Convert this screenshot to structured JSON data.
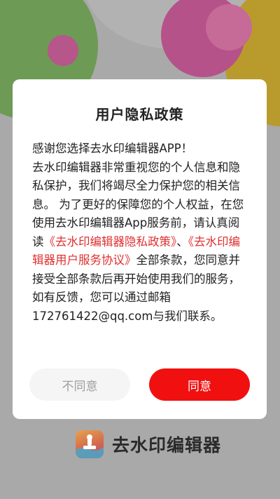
{
  "dialog": {
    "title": "用户隐私政策",
    "body": {
      "greeting": "感谢您选择去水印编辑器APP！",
      "intro": "去水印编辑器非常重视您的个人信息和隐私保护，我们将竭尽全力保护您的相关信息。 为了更好的保障您的个人权益，在您使用去水印编辑器App服务前，请认真阅读",
      "privacy_link": "《去水印编辑器隐私政策》",
      "joiner": "、",
      "agreement_link": "《去水印编辑器用户服务协议》",
      "outro": "全部条款，您同意并接受全部条款后再开始使用我们的服务，如有反馈，您可以通过邮箱172761422@qq.com与我们联系。"
    },
    "disagree_label": "不同意",
    "agree_label": "同意"
  },
  "brand": {
    "name": "去水印编辑器",
    "icon": "stamp-app-icon"
  },
  "colors": {
    "link": "#e03030",
    "agree_button": "#f01010",
    "disagree_button": "#f5f5f5"
  }
}
